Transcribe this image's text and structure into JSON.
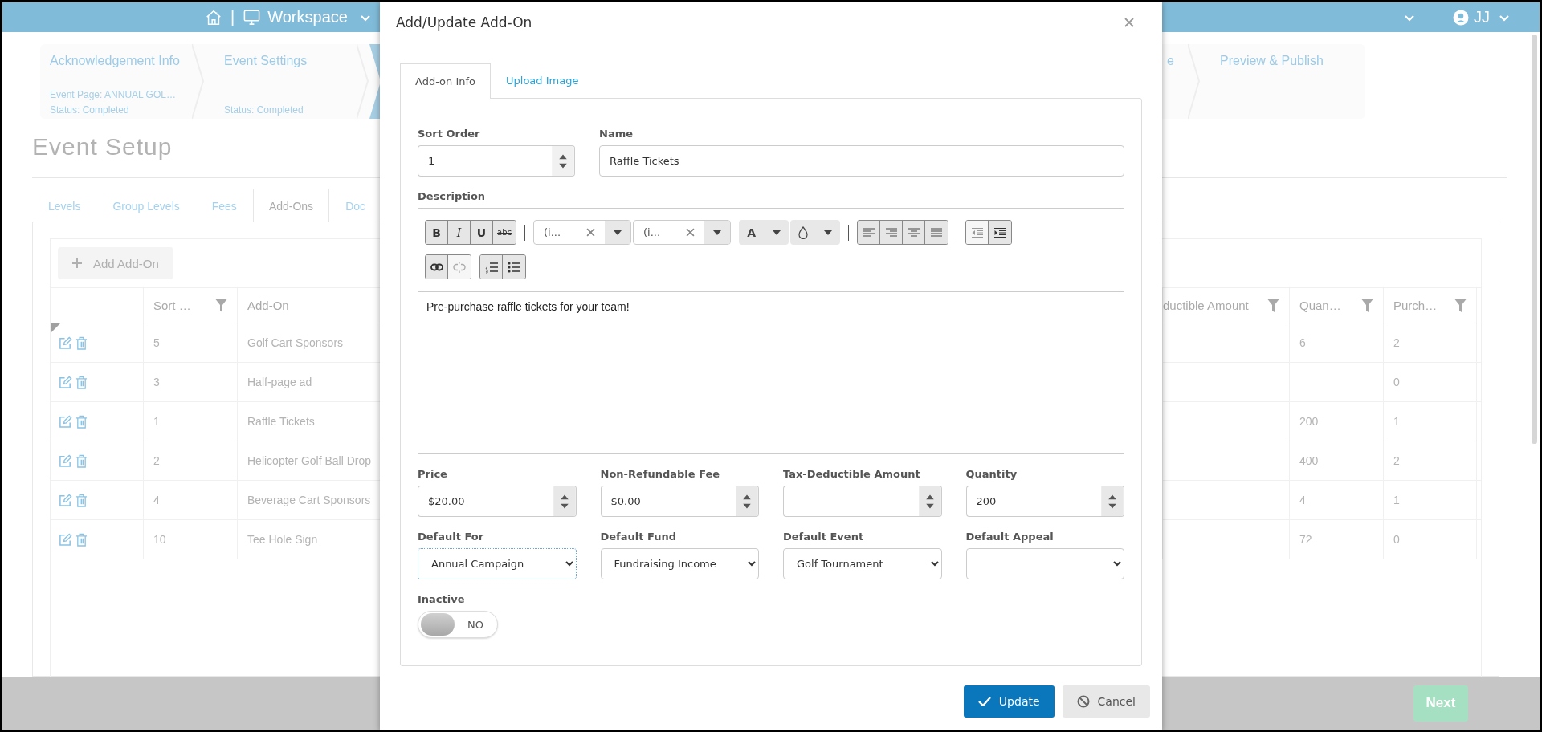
{
  "top_bar": {
    "separator": "|",
    "workspace": "Workspace",
    "user": "JJ"
  },
  "steps": [
    {
      "title": "Acknowledgement Info",
      "lines": [
        "Event Page: ANNUAL GOL…",
        "Status: Completed"
      ],
      "selected": false
    },
    {
      "title": "Event Settings",
      "lines": [
        "Status: Completed"
      ],
      "selected": false
    },
    {
      "selected": true
    },
    {
      "title": "e",
      "selected": false
    },
    {
      "title": "Preview & Publish",
      "selected": false
    }
  ],
  "page_title": "Event Setup",
  "tabs": [
    {
      "label": "Levels",
      "selected": false
    },
    {
      "label": "Group Levels",
      "selected": false
    },
    {
      "label": "Fees",
      "selected": false
    },
    {
      "label": "Add-Ons",
      "selected": true
    },
    {
      "label": "Doc",
      "selected": false
    }
  ],
  "add_button": "Add Add-On",
  "table": {
    "columns": [
      {
        "label": "Sort …",
        "filter": true
      },
      {
        "label": "Add-On",
        "filter": false
      },
      {
        "label": "ductible Amount",
        "filter": true
      },
      {
        "label": "Quan…",
        "filter": true
      },
      {
        "label": "Purch…",
        "filter": true
      }
    ],
    "rows": [
      {
        "marked": true,
        "sort": "5",
        "add_on": "Golf Cart Sponsors",
        "quantity": "6",
        "purchased": "2"
      },
      {
        "marked": false,
        "sort": "3",
        "add_on": "Half-page ad",
        "purchased": "0"
      },
      {
        "marked": false,
        "sort": "1",
        "add_on": "Raffle Tickets",
        "quantity": "200",
        "purchased": "1"
      },
      {
        "marked": false,
        "sort": "2",
        "add_on": "Helicopter Golf Ball Drop",
        "quantity": "400",
        "purchased": "2"
      },
      {
        "marked": false,
        "sort": "4",
        "add_on": "Beverage Cart Sponsors",
        "quantity": "4",
        "purchased": "1"
      },
      {
        "marked": false,
        "sort": "10",
        "add_on": "Tee Hole Sign",
        "quantity": "72",
        "purchased": "0"
      }
    ]
  },
  "next_button": "Next",
  "dialog": {
    "title": "Add/Update Add-On",
    "tabs": [
      {
        "label": "Add-on Info",
        "selected": true
      },
      {
        "label": "Upload Image",
        "selected": false
      }
    ],
    "sort_order": {
      "label": "Sort Order",
      "value": "1"
    },
    "name": {
      "label": "Name",
      "value": "Raffle Tickets"
    },
    "description": {
      "label": "Description",
      "value": "Pre-purchase raffle tickets for your team!",
      "toolbar_rows": [
        {
          "groups": [
            {
              "kind": "buttons",
              "buttons": [
                {
                  "kind": "bold",
                  "label": "B",
                  "disabled": false
                },
                {
                  "kind": "italic",
                  "label": "I",
                  "disabled": false
                },
                {
                  "kind": "underline",
                  "label": "U",
                  "disabled": false
                },
                {
                  "kind": "strike",
                  "label": "abc",
                  "disabled": false
                }
              ]
            },
            {
              "kind": "separator"
            },
            {
              "kind": "combos",
              "combos": [
                {
                  "kind": "clearable",
                  "label": "(i..."
                },
                {
                  "kind": "clearable",
                  "label": "(i..."
                }
              ]
            },
            {
              "kind": "combos",
              "combos": [
                {
                  "kind": "text-color",
                  "label": "A"
                },
                {
                  "kind": "highlight"
                }
              ]
            },
            {
              "kind": "separator"
            },
            {
              "kind": "buttons",
              "buttons": [
                {
                  "kind": "align-left",
                  "disabled": false
                },
                {
                  "kind": "align-right",
                  "disabled": false
                },
                {
                  "kind": "align-center",
                  "disabled": false
                },
                {
                  "kind": "justify",
                  "disabled": false
                }
              ]
            },
            {
              "kind": "separator"
            },
            {
              "kind": "buttons",
              "buttons": [
                {
                  "kind": "outdent",
                  "disabled": true
                },
                {
                  "kind": "indent",
                  "disabled": false
                }
              ]
            }
          ]
        },
        {
          "groups": [
            {
              "kind": "buttons",
              "buttons": [
                {
                  "kind": "link",
                  "disabled": false
                },
                {
                  "kind": "unlink",
                  "disabled": true
                }
              ]
            },
            {
              "kind": "buttons",
              "buttons": [
                {
                  "kind": "ordered-list",
                  "disabled": false
                },
                {
                  "kind": "bullet-list",
                  "disabled": false
                }
              ]
            }
          ]
        }
      ]
    },
    "amounts": [
      {
        "label": "Price",
        "value": "$20.00"
      },
      {
        "label": "Non-Refundable Fee",
        "value": "$0.00"
      },
      {
        "label": "Tax-Deductible Amount"
      },
      {
        "label": "Quantity",
        "value": "200"
      }
    ],
    "selects": [
      {
        "label": "Default For",
        "value": "Annual Campaign",
        "focused": true
      },
      {
        "label": "Default Fund",
        "value": "Fundraising Income",
        "focused": false
      },
      {
        "label": "Default Event",
        "value": "Golf Tournament",
        "focused": false
      },
      {
        "label": "Default Appeal",
        "focused": false
      }
    ],
    "inactive": {
      "label": "Inactive",
      "on": false,
      "state_text": "NO"
    },
    "buttons": [
      {
        "kind": "primary",
        "label": "Update"
      },
      {
        "kind": "secondary",
        "label": "Cancel"
      }
    ]
  }
}
